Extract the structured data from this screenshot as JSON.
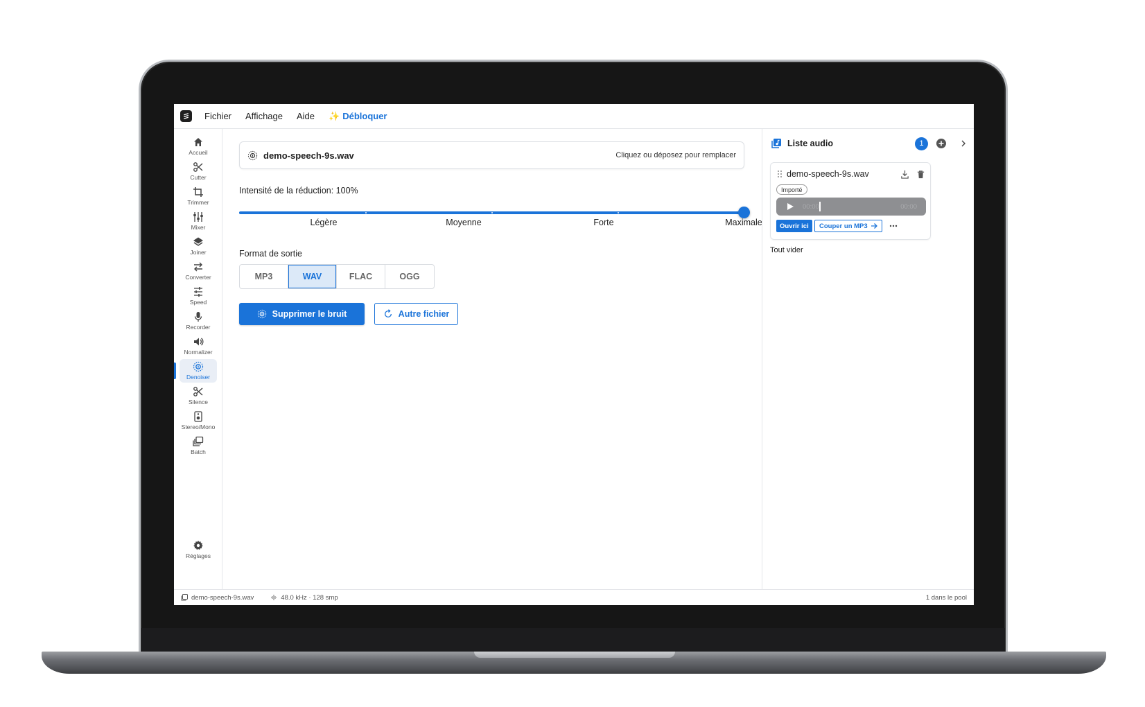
{
  "menu": {
    "items": [
      "Fichier",
      "Affichage",
      "Aide"
    ],
    "unlock_label": "Débloquer",
    "unlock_icon": "sparkles-icon"
  },
  "sidebar": {
    "items": [
      {
        "label": "Accueil",
        "icon": "home-icon"
      },
      {
        "label": "Cutter",
        "icon": "scissors-icon"
      },
      {
        "label": "Trimmer",
        "icon": "crop-icon"
      },
      {
        "label": "Mixer",
        "icon": "mixer-icon"
      },
      {
        "label": "Joiner",
        "icon": "layers-icon"
      },
      {
        "label": "Converter",
        "icon": "swap-icon"
      },
      {
        "label": "Speed",
        "icon": "tune-icon"
      },
      {
        "label": "Recorder",
        "icon": "microphone-icon"
      },
      {
        "label": "Normalizer",
        "icon": "volume-icon"
      },
      {
        "label": "Denoiser",
        "icon": "denoise-icon",
        "active": true
      },
      {
        "label": "Silence",
        "icon": "scissors-icon"
      },
      {
        "label": "Stereo/Mono",
        "icon": "speaker-icon"
      },
      {
        "label": "Batch",
        "icon": "library-icon"
      }
    ],
    "settings_label": "Réglages"
  },
  "main": {
    "file_name": "demo-speech-9s.wav",
    "replace_hint": "Cliquez ou déposez pour remplacer",
    "intensity_label": "Intensité de la réduction: 100%",
    "intensity_value": 1.0,
    "marks": [
      "Légère",
      "Moyenne",
      "Forte",
      "Maximale"
    ],
    "format_label": "Format de sortie",
    "formats": [
      "MP3",
      "WAV",
      "FLAC",
      "OGG"
    ],
    "selected_format": "WAV",
    "primary_button": "Supprimer le bruit",
    "secondary_button": "Autre fichier"
  },
  "right_panel": {
    "title": "Liste audio",
    "count": "1",
    "item": {
      "name": "demo-speech-9s.wav",
      "badge": "Importé",
      "time_current": "00:00",
      "time_total": "00:00",
      "open_label": "Ouvrir ici",
      "cut_label": "Couper un MP3"
    },
    "clear_label": "Tout vider"
  },
  "status": {
    "file": "demo-speech-9s.wav",
    "info": "48.0 kHz · 128 smp",
    "pool": "1 dans le pool"
  },
  "colors": {
    "accent": "#1a73d9",
    "active_bg": "#e9eef6",
    "player_bg": "#8e8f92"
  }
}
